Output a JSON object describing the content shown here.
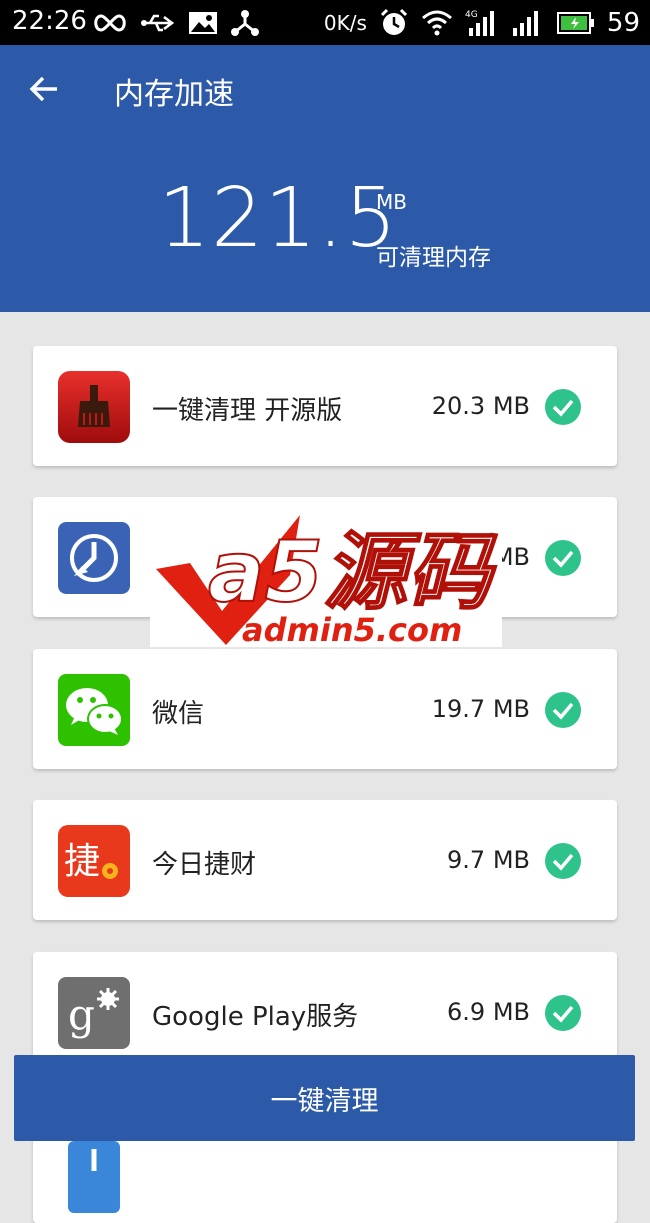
{
  "status_bar": {
    "time": "22:26",
    "net_speed": "0K/s",
    "battery": "59"
  },
  "app_bar": {
    "title": "内存加速"
  },
  "summary": {
    "value": "121.5",
    "unit": "MB",
    "label": "可清理内存"
  },
  "apps": [
    {
      "name": "一键清理 开源版",
      "size": "20.3 MB",
      "checked": true
    },
    {
      "name": "",
      "size": "MB",
      "checked": true
    },
    {
      "name": "微信",
      "size": "19.7 MB",
      "checked": true
    },
    {
      "name": "今日捷财",
      "size": "9.7 MB",
      "checked": true
    },
    {
      "name": "Google Play服务",
      "size": "6.9 MB",
      "checked": true
    }
  ],
  "watermark": {
    "brand": "a5源码",
    "domain": "admin5.com"
  },
  "action": {
    "label": "一键清理"
  },
  "colors": {
    "primary": "#2c5aa8",
    "check": "#2ec38b"
  }
}
